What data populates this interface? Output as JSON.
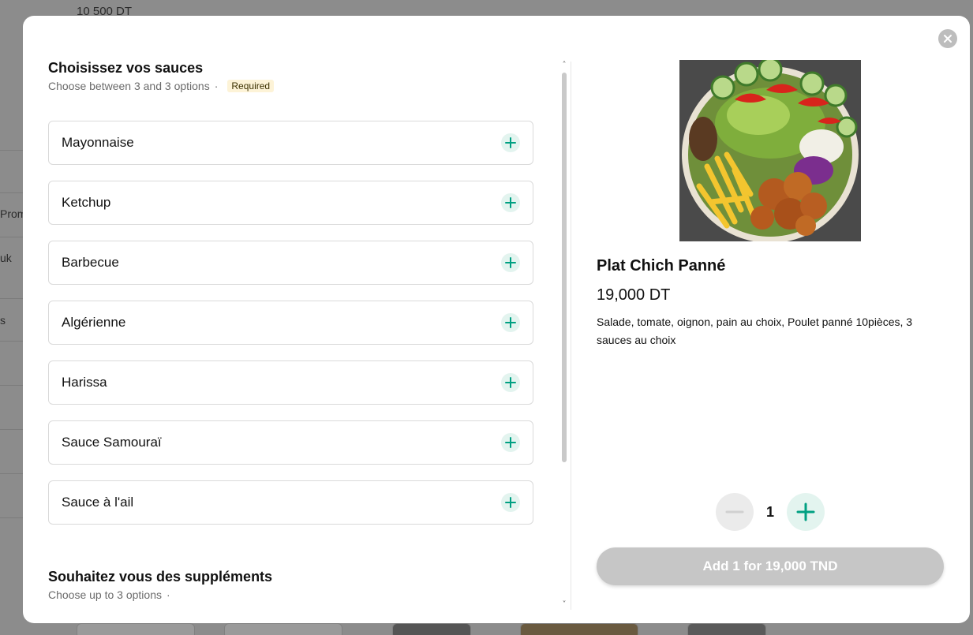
{
  "background": {
    "price_text": "10 500 DT",
    "frag_1": "Prom",
    "frag_2": "uk",
    "frag_3": "s"
  },
  "sauces_section": {
    "title": "Choisissez vos sauces",
    "subtitle": "Choose between 3 and 3 options",
    "separator": "·",
    "badge": "Required",
    "options": [
      {
        "label": "Mayonnaise"
      },
      {
        "label": "Ketchup"
      },
      {
        "label": "Barbecue"
      },
      {
        "label": "Algérienne"
      },
      {
        "label": "Harissa"
      },
      {
        "label": "Sauce Samouraï"
      },
      {
        "label": "Sauce à l'ail"
      }
    ]
  },
  "supplements_section": {
    "title": "Souhaitez vous des suppléments",
    "subtitle": "Choose up to 3 options",
    "separator": "·"
  },
  "product": {
    "name": "Plat Chich Panné",
    "price": "19,000 DT",
    "description": "Salade, tomate, oignon, pain au choix, Poulet panné 10pièces, 3 sauces au choix",
    "quantity": "1",
    "add_button_label": "Add 1 for 19,000 TND"
  },
  "icons": {
    "close": "close-icon",
    "plus": "plus-icon",
    "minus": "minus-icon",
    "scroll_up": "chevron-up-icon",
    "scroll_down": "chevron-down-icon"
  },
  "colors": {
    "accent": "#00a082",
    "accent_bg": "#e3f4ef",
    "badge_bg": "#fdf3d7",
    "disabled_button": "#c6c6c6"
  }
}
